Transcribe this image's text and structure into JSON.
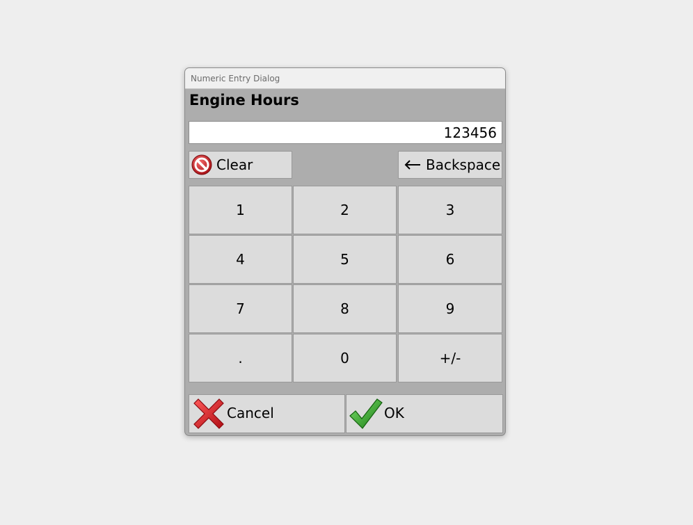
{
  "dialog": {
    "title": "Numeric Entry Dialog",
    "field_label": "Engine Hours",
    "value": "123456"
  },
  "buttons": {
    "clear_label": "Clear",
    "backspace_label": "Backspace",
    "cancel_label": "Cancel",
    "ok_label": "OK"
  },
  "keypad": {
    "keys": [
      "1",
      "2",
      "3",
      "4",
      "5",
      "6",
      "7",
      "8",
      "9",
      ".",
      "0",
      "+/-"
    ]
  },
  "icons": {
    "clear": "no-entry-icon",
    "backspace": "left-arrow-icon",
    "cancel": "red-x-icon",
    "ok": "green-check-icon"
  },
  "colors": {
    "dialog_bg": "#adadad",
    "button_bg": "#dcdcdc",
    "cancel_red": "#d8141f",
    "ok_green": "#2a9a22"
  }
}
